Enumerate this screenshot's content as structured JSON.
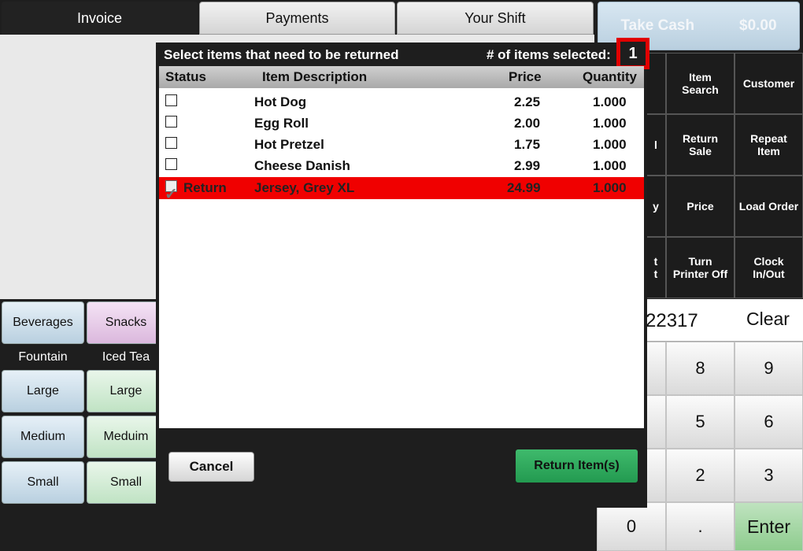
{
  "tabs": [
    "Invoice",
    "Payments",
    "Your Shift"
  ],
  "take_cash": {
    "label": "Take Cash",
    "amount": "$0.00"
  },
  "functions": {
    "col0": [
      "",
      "l",
      "y",
      "t\nt"
    ],
    "item_search": "Item\nSearch",
    "customer": "Customer",
    "return_sale": "Return\nSale",
    "repeat_item": "Repeat\nItem",
    "price": "Price",
    "load_order": "Load Order",
    "turn_printer_off": "Turn\nPrinter Off",
    "clock_in_out": "Clock\nIn/Out"
  },
  "entry": {
    "value": "22317",
    "clear": "Clear"
  },
  "keypad": {
    "k8": "8",
    "k9": "9",
    "k5": "5",
    "k6": "6",
    "k2": "2",
    "k3": "3",
    "k0": "0",
    "dot": ".",
    "enter": "Enter"
  },
  "categories": {
    "beverages": "Beverages",
    "snacks": "Snacks",
    "fountain": "Fountain",
    "iced_tea": "Iced Tea",
    "large_1": "Large",
    "large_2": "Large",
    "medium": "Medium",
    "meduim": "Meduim",
    "small_1": "Small",
    "small_2": "Small"
  },
  "modal": {
    "title": "Select items that need to be returned",
    "count_label": "# of items selected:",
    "count": "1",
    "columns": {
      "status": "Status",
      "description": "Item Description",
      "price": "Price",
      "quantity": "Quantity"
    },
    "rows": [
      {
        "status": "",
        "description": "Hot Dog",
        "price": "2.25",
        "quantity": "1.000"
      },
      {
        "status": "",
        "description": "Egg Roll",
        "price": "2.00",
        "quantity": "1.000"
      },
      {
        "status": "",
        "description": "Hot Pretzel",
        "price": "1.75",
        "quantity": "1.000"
      },
      {
        "status": "",
        "description": "Cheese Danish",
        "price": "2.99",
        "quantity": "1.000"
      },
      {
        "status": "Return",
        "description": "Jersey, Grey XL",
        "price": "24.99",
        "quantity": "1.000"
      }
    ],
    "cancel": "Cancel",
    "return_items": "Return Item(s)"
  },
  "colors": {
    "selected_row": "#f00000",
    "return_button": "#2aa55a",
    "highlight_box": "#e10000"
  }
}
